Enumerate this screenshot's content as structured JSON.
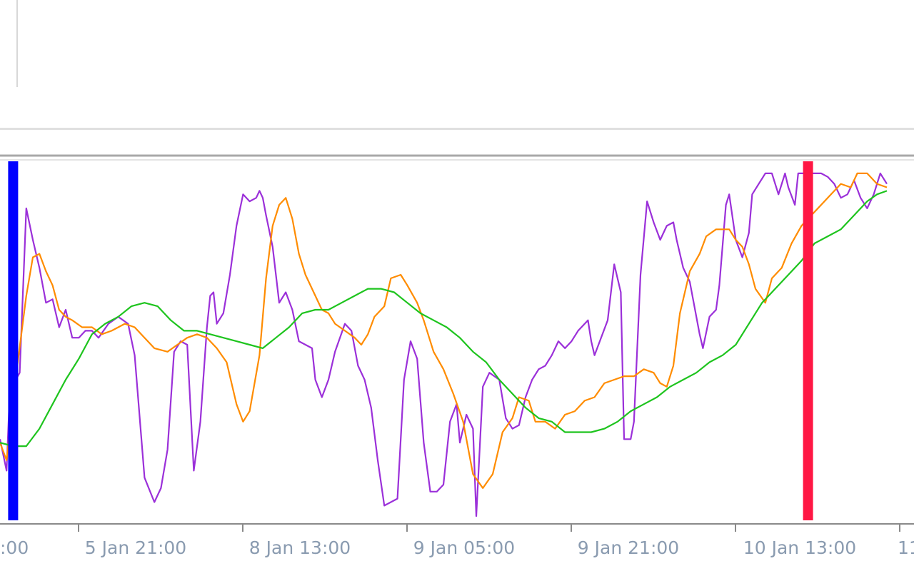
{
  "chart_data": {
    "type": "line",
    "title": "",
    "xlabel": "",
    "ylabel": "",
    "ylim": [
      0,
      100
    ],
    "grid": false,
    "legend": "none",
    "x_tick_labels": [
      ":00",
      "5 Jan 21:00",
      "8 Jan 13:00",
      "9 Jan 05:00",
      "9 Jan 21:00",
      "10 Jan 13:00",
      "11"
    ],
    "markers": [
      {
        "position": 0.4,
        "color": "#0000ff"
      },
      {
        "position": 24.6,
        "color": "#ff1744"
      }
    ],
    "series": [
      {
        "color": "#9b30d9",
        "values": [
          [
            0,
            23
          ],
          [
            0.2,
            14
          ],
          [
            0.3,
            37
          ],
          [
            0.6,
            42
          ],
          [
            0.8,
            89
          ],
          [
            1,
            80
          ],
          [
            1.2,
            72
          ],
          [
            1.4,
            62
          ],
          [
            1.6,
            63
          ],
          [
            1.8,
            55
          ],
          [
            2,
            60
          ],
          [
            2.2,
            52
          ],
          [
            2.4,
            52
          ],
          [
            2.6,
            54
          ],
          [
            2.8,
            54
          ],
          [
            3,
            52
          ],
          [
            3.3,
            56
          ],
          [
            3.6,
            58
          ],
          [
            3.9,
            56
          ],
          [
            4.1,
            47
          ],
          [
            4.4,
            12
          ],
          [
            4.7,
            5
          ],
          [
            4.9,
            9
          ],
          [
            5.1,
            20
          ],
          [
            5.3,
            48
          ],
          [
            5.5,
            51
          ],
          [
            5.7,
            50
          ],
          [
            5.9,
            14
          ],
          [
            6.1,
            28
          ],
          [
            6.3,
            55
          ],
          [
            6.4,
            64
          ],
          [
            6.5,
            65
          ],
          [
            6.6,
            56
          ],
          [
            6.8,
            59
          ],
          [
            7.0,
            70
          ],
          [
            7.2,
            84
          ],
          [
            7.4,
            93
          ],
          [
            7.6,
            91
          ],
          [
            7.8,
            92
          ],
          [
            7.9,
            94
          ],
          [
            8.0,
            92
          ],
          [
            8.1,
            87
          ],
          [
            8.3,
            78
          ],
          [
            8.5,
            62
          ],
          [
            8.7,
            65
          ],
          [
            8.9,
            60
          ],
          [
            9.1,
            51
          ],
          [
            9.3,
            50
          ],
          [
            9.5,
            49
          ],
          [
            9.6,
            40
          ],
          [
            9.8,
            35
          ],
          [
            10.0,
            40
          ],
          [
            10.2,
            48
          ],
          [
            10.5,
            56
          ],
          [
            10.7,
            54
          ],
          [
            10.9,
            44
          ],
          [
            11.1,
            40
          ],
          [
            11.3,
            32
          ],
          [
            11.5,
            17
          ],
          [
            11.7,
            4
          ],
          [
            11.9,
            5
          ],
          [
            12.1,
            6
          ],
          [
            12.3,
            40
          ],
          [
            12.5,
            51
          ],
          [
            12.7,
            46
          ],
          [
            12.9,
            22
          ],
          [
            13.1,
            8
          ],
          [
            13.3,
            8
          ],
          [
            13.5,
            10
          ],
          [
            13.7,
            28
          ],
          [
            13.9,
            33
          ],
          [
            14.0,
            22
          ],
          [
            14.2,
            30
          ],
          [
            14.4,
            26
          ],
          [
            14.5,
            1
          ],
          [
            14.7,
            38
          ],
          [
            14.9,
            42
          ],
          [
            15.2,
            40
          ],
          [
            15.4,
            29
          ],
          [
            15.6,
            26
          ],
          [
            15.8,
            27
          ],
          [
            16.0,
            35
          ],
          [
            16.2,
            40
          ],
          [
            16.4,
            43
          ],
          [
            16.6,
            44
          ],
          [
            16.8,
            47
          ],
          [
            17.0,
            51
          ],
          [
            17.2,
            49
          ],
          [
            17.4,
            51
          ],
          [
            17.6,
            54
          ],
          [
            17.9,
            57
          ],
          [
            18.0,
            51
          ],
          [
            18.1,
            47
          ],
          [
            18.3,
            52
          ],
          [
            18.5,
            57
          ],
          [
            18.7,
            73
          ],
          [
            18.9,
            65
          ],
          [
            19.0,
            23
          ],
          [
            19.2,
            23
          ],
          [
            19.3,
            28
          ],
          [
            19.5,
            70
          ],
          [
            19.7,
            91
          ],
          [
            19.9,
            85
          ],
          [
            20.1,
            80
          ],
          [
            20.3,
            84
          ],
          [
            20.5,
            85
          ],
          [
            20.6,
            80
          ],
          [
            20.8,
            72
          ],
          [
            21.0,
            68
          ],
          [
            21.1,
            63
          ],
          [
            21.3,
            53
          ],
          [
            21.4,
            49
          ],
          [
            21.6,
            58
          ],
          [
            21.8,
            60
          ],
          [
            21.9,
            67
          ],
          [
            22.1,
            90
          ],
          [
            22.2,
            93
          ],
          [
            22.4,
            80
          ],
          [
            22.6,
            75
          ],
          [
            22.8,
            82
          ],
          [
            22.9,
            93
          ],
          [
            23.1,
            96
          ],
          [
            23.3,
            99
          ],
          [
            23.5,
            99
          ],
          [
            23.7,
            93
          ],
          [
            23.9,
            99
          ],
          [
            24.0,
            95
          ],
          [
            24.2,
            90
          ],
          [
            24.3,
            99
          ],
          [
            24.5,
            99
          ],
          [
            24.8,
            99
          ],
          [
            25.0,
            99
          ],
          [
            25.2,
            98
          ],
          [
            25.4,
            96
          ],
          [
            25.6,
            92
          ],
          [
            25.8,
            93
          ],
          [
            26.0,
            97
          ],
          [
            26.2,
            92
          ],
          [
            26.4,
            89
          ],
          [
            26.6,
            93
          ],
          [
            26.8,
            99
          ],
          [
            27.0,
            96
          ]
        ]
      },
      {
        "color": "#ff8c00",
        "values": [
          [
            0,
            22
          ],
          [
            0.2,
            17
          ],
          [
            0.5,
            42
          ],
          [
            0.8,
            64
          ],
          [
            1.0,
            75
          ],
          [
            1.2,
            76
          ],
          [
            1.4,
            71
          ],
          [
            1.6,
            67
          ],
          [
            1.8,
            60
          ],
          [
            2.0,
            58
          ],
          [
            2.2,
            57
          ],
          [
            2.5,
            55
          ],
          [
            2.8,
            55
          ],
          [
            3.1,
            53
          ],
          [
            3.4,
            54
          ],
          [
            3.8,
            56
          ],
          [
            4.1,
            55
          ],
          [
            4.4,
            52
          ],
          [
            4.7,
            49
          ],
          [
            5.1,
            48
          ],
          [
            5.4,
            50
          ],
          [
            5.7,
            52
          ],
          [
            6.0,
            53
          ],
          [
            6.3,
            52
          ],
          [
            6.6,
            49
          ],
          [
            6.9,
            45
          ],
          [
            7.2,
            33
          ],
          [
            7.4,
            28
          ],
          [
            7.6,
            31
          ],
          [
            7.9,
            47
          ],
          [
            8.1,
            69
          ],
          [
            8.3,
            84
          ],
          [
            8.5,
            90
          ],
          [
            8.7,
            92
          ],
          [
            8.9,
            86
          ],
          [
            9.1,
            76
          ],
          [
            9.3,
            70
          ],
          [
            9.5,
            66
          ],
          [
            9.8,
            60
          ],
          [
            10.0,
            59
          ],
          [
            10.2,
            56
          ],
          [
            10.5,
            54
          ],
          [
            10.8,
            52
          ],
          [
            11.0,
            50
          ],
          [
            11.2,
            53
          ],
          [
            11.4,
            58
          ],
          [
            11.7,
            61
          ],
          [
            11.9,
            69
          ],
          [
            12.2,
            70
          ],
          [
            12.4,
            67
          ],
          [
            12.7,
            62
          ],
          [
            12.9,
            57
          ],
          [
            13.2,
            48
          ],
          [
            13.5,
            43
          ],
          [
            13.8,
            36
          ],
          [
            14.1,
            28
          ],
          [
            14.4,
            13
          ],
          [
            14.7,
            9
          ],
          [
            15.0,
            13
          ],
          [
            15.3,
            25
          ],
          [
            15.6,
            29
          ],
          [
            15.8,
            35
          ],
          [
            16.1,
            34
          ],
          [
            16.3,
            28
          ],
          [
            16.6,
            28
          ],
          [
            16.9,
            26
          ],
          [
            17.2,
            30
          ],
          [
            17.5,
            31
          ],
          [
            17.8,
            34
          ],
          [
            18.1,
            35
          ],
          [
            18.4,
            39
          ],
          [
            18.7,
            40
          ],
          [
            19.0,
            41
          ],
          [
            19.3,
            41
          ],
          [
            19.6,
            43
          ],
          [
            19.9,
            42
          ],
          [
            20.1,
            39
          ],
          [
            20.3,
            38
          ],
          [
            20.5,
            44
          ],
          [
            20.7,
            59
          ],
          [
            21.0,
            71
          ],
          [
            21.3,
            76
          ],
          [
            21.5,
            81
          ],
          [
            21.8,
            83
          ],
          [
            22.0,
            83
          ],
          [
            22.2,
            83
          ],
          [
            22.4,
            80
          ],
          [
            22.6,
            78
          ],
          [
            22.8,
            73
          ],
          [
            23.0,
            66
          ],
          [
            23.3,
            62
          ],
          [
            23.5,
            69
          ],
          [
            23.8,
            72
          ],
          [
            24.1,
            79
          ],
          [
            24.4,
            84
          ],
          [
            24.7,
            87
          ],
          [
            25.0,
            90
          ],
          [
            25.3,
            93
          ],
          [
            25.6,
            96
          ],
          [
            25.9,
            95
          ],
          [
            26.1,
            99
          ],
          [
            26.4,
            99
          ],
          [
            26.7,
            96
          ],
          [
            27.0,
            95
          ]
        ]
      },
      {
        "color": "#1ec41e",
        "values": [
          [
            0,
            22
          ],
          [
            0.4,
            21
          ],
          [
            0.8,
            21
          ],
          [
            1.2,
            26
          ],
          [
            1.6,
            33
          ],
          [
            2.0,
            40
          ],
          [
            2.4,
            46
          ],
          [
            2.8,
            53
          ],
          [
            3.2,
            56
          ],
          [
            3.6,
            58
          ],
          [
            4.0,
            61
          ],
          [
            4.4,
            62
          ],
          [
            4.8,
            61
          ],
          [
            5.2,
            57
          ],
          [
            5.6,
            54
          ],
          [
            6.0,
            54
          ],
          [
            6.4,
            53
          ],
          [
            6.8,
            52
          ],
          [
            7.2,
            51
          ],
          [
            7.6,
            50
          ],
          [
            8.0,
            49
          ],
          [
            8.4,
            52
          ],
          [
            8.8,
            55
          ],
          [
            9.2,
            59
          ],
          [
            9.6,
            60
          ],
          [
            10.0,
            60
          ],
          [
            10.4,
            62
          ],
          [
            10.8,
            64
          ],
          [
            11.2,
            66
          ],
          [
            11.6,
            66
          ],
          [
            12.0,
            65
          ],
          [
            12.4,
            62
          ],
          [
            12.8,
            59
          ],
          [
            13.2,
            57
          ],
          [
            13.6,
            55
          ],
          [
            14.0,
            52
          ],
          [
            14.4,
            48
          ],
          [
            14.8,
            45
          ],
          [
            15.2,
            40
          ],
          [
            15.6,
            36
          ],
          [
            16.0,
            32
          ],
          [
            16.4,
            29
          ],
          [
            16.8,
            28
          ],
          [
            17.2,
            25
          ],
          [
            17.6,
            25
          ],
          [
            18.0,
            25
          ],
          [
            18.4,
            26
          ],
          [
            18.8,
            28
          ],
          [
            19.2,
            31
          ],
          [
            19.6,
            33
          ],
          [
            20.0,
            35
          ],
          [
            20.4,
            38
          ],
          [
            20.8,
            40
          ],
          [
            21.2,
            42
          ],
          [
            21.6,
            45
          ],
          [
            22.0,
            47
          ],
          [
            22.4,
            50
          ],
          [
            22.8,
            56
          ],
          [
            23.2,
            62
          ],
          [
            23.6,
            66
          ],
          [
            24.0,
            70
          ],
          [
            24.4,
            74
          ],
          [
            24.8,
            79
          ],
          [
            25.2,
            81
          ],
          [
            25.6,
            83
          ],
          [
            26.0,
            87
          ],
          [
            26.4,
            91
          ],
          [
            26.7,
            93
          ],
          [
            27.0,
            94
          ]
        ]
      }
    ]
  }
}
